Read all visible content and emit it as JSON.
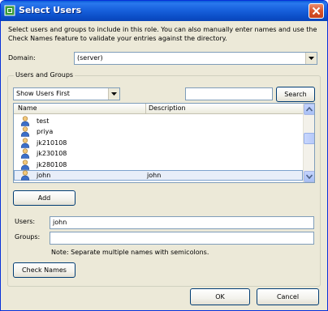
{
  "window": {
    "title": "Select Users"
  },
  "intro_text": "Select users and groups to include in this role. You can also manually enter names and use the Check Names feature to validate your entries against the directory.",
  "domain": {
    "label": "Domain:",
    "value": "(server)"
  },
  "users_and_groups": {
    "legend": "Users and Groups",
    "filter_value": "Show Users First",
    "search_value": "",
    "search_label": "Search",
    "columns": [
      "Name",
      "Description"
    ],
    "rows": [
      {
        "name": "test",
        "description": ""
      },
      {
        "name": "priya",
        "description": ""
      },
      {
        "name": "jk210108",
        "description": ""
      },
      {
        "name": "jk230108",
        "description": ""
      },
      {
        "name": "jk280108",
        "description": ""
      },
      {
        "name": "john",
        "description": "john",
        "selected": true
      }
    ],
    "add_label": "Add",
    "users_label": "Users:",
    "users_value": "john",
    "groups_label": "Groups:",
    "groups_value": "",
    "note": "Note: Separate multiple names with semicolons.",
    "check_names_label": "Check Names"
  },
  "footer": {
    "ok_label": "OK",
    "cancel_label": "Cancel"
  },
  "colors": {
    "titlebar": "#0a5bd9",
    "dialog_bg": "#ece9d8",
    "selection": "#e8eef9",
    "input_border": "#7f9db9"
  },
  "icons": [
    "app-icon",
    "close-icon",
    "dropdown-arrow-icon",
    "user-icon",
    "scroll-up-icon",
    "scroll-down-icon"
  ]
}
